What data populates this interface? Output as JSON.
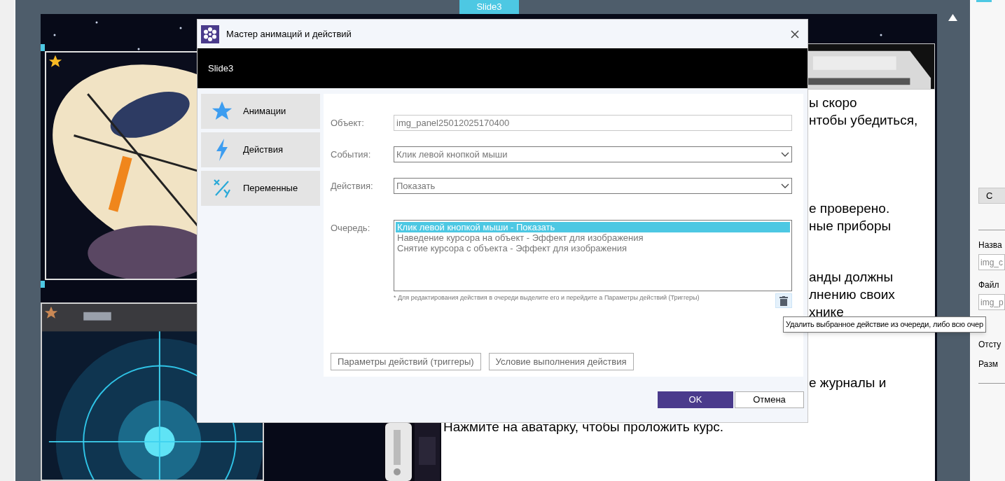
{
  "slide_tab": "Slide3",
  "slide": {
    "images": [
      {
        "kind": "ship",
        "starred": true
      },
      {
        "kind": "radar",
        "starred": true
      },
      {
        "kind": "device",
        "starred": false
      },
      {
        "kind": "gadget",
        "starred": false
      }
    ],
    "text_paragraphs": [
      [
        "ы скоро",
        "нтобы убедиться,"
      ],
      [
        "е проверено.",
        "ные приборы"
      ],
      [
        "анды должны",
        "лнению своих",
        "хнике"
      ],
      [
        "е журналы и"
      ]
    ],
    "bottom_text": "Нажмите на аватарку, чтобы проложить курс."
  },
  "dialog": {
    "title": "Мастер анимаций и действий",
    "header": "Slide3",
    "nav": [
      {
        "kind": "animations",
        "label": "Анимации"
      },
      {
        "kind": "actions",
        "label": "Действия"
      },
      {
        "kind": "variables",
        "label": "Переменные"
      }
    ],
    "fields": [
      {
        "kind": "text",
        "label": "Объект:",
        "value": "img_panel25012025170400"
      },
      {
        "kind": "select",
        "label": "События:",
        "value": "Клик левой кнопкой мыши"
      },
      {
        "kind": "select",
        "label": "Действия:",
        "value": "Показать"
      }
    ],
    "queue": {
      "label": "Очередь:",
      "items": [
        {
          "text": "Клик левой кнопкой мыши - Показать",
          "selected": true
        },
        {
          "text": "Наведение курсора на объект - Эффект для изображения",
          "selected": false
        },
        {
          "text": "Снятие курсора с объекта - Эффект для изображения",
          "selected": false
        }
      ],
      "note": "* Для редактирования действия в очереди выделите его и перейдите а Параметры действий (Триггеры)"
    },
    "buttons": [
      "Параметры действий (триггеры)",
      "Условие выполнения действия"
    ],
    "ok": "OK",
    "cancel": "Отмена"
  },
  "tooltip": "Удалить выбранное действие из очереди, либо всю очер",
  "right_panel": {
    "button": "С",
    "fields": [
      {
        "label": "Назва",
        "value": "img_c"
      },
      {
        "label": "Файл",
        "value": "img_p"
      }
    ],
    "labels": [
      "Отсту",
      "Разм"
    ]
  }
}
